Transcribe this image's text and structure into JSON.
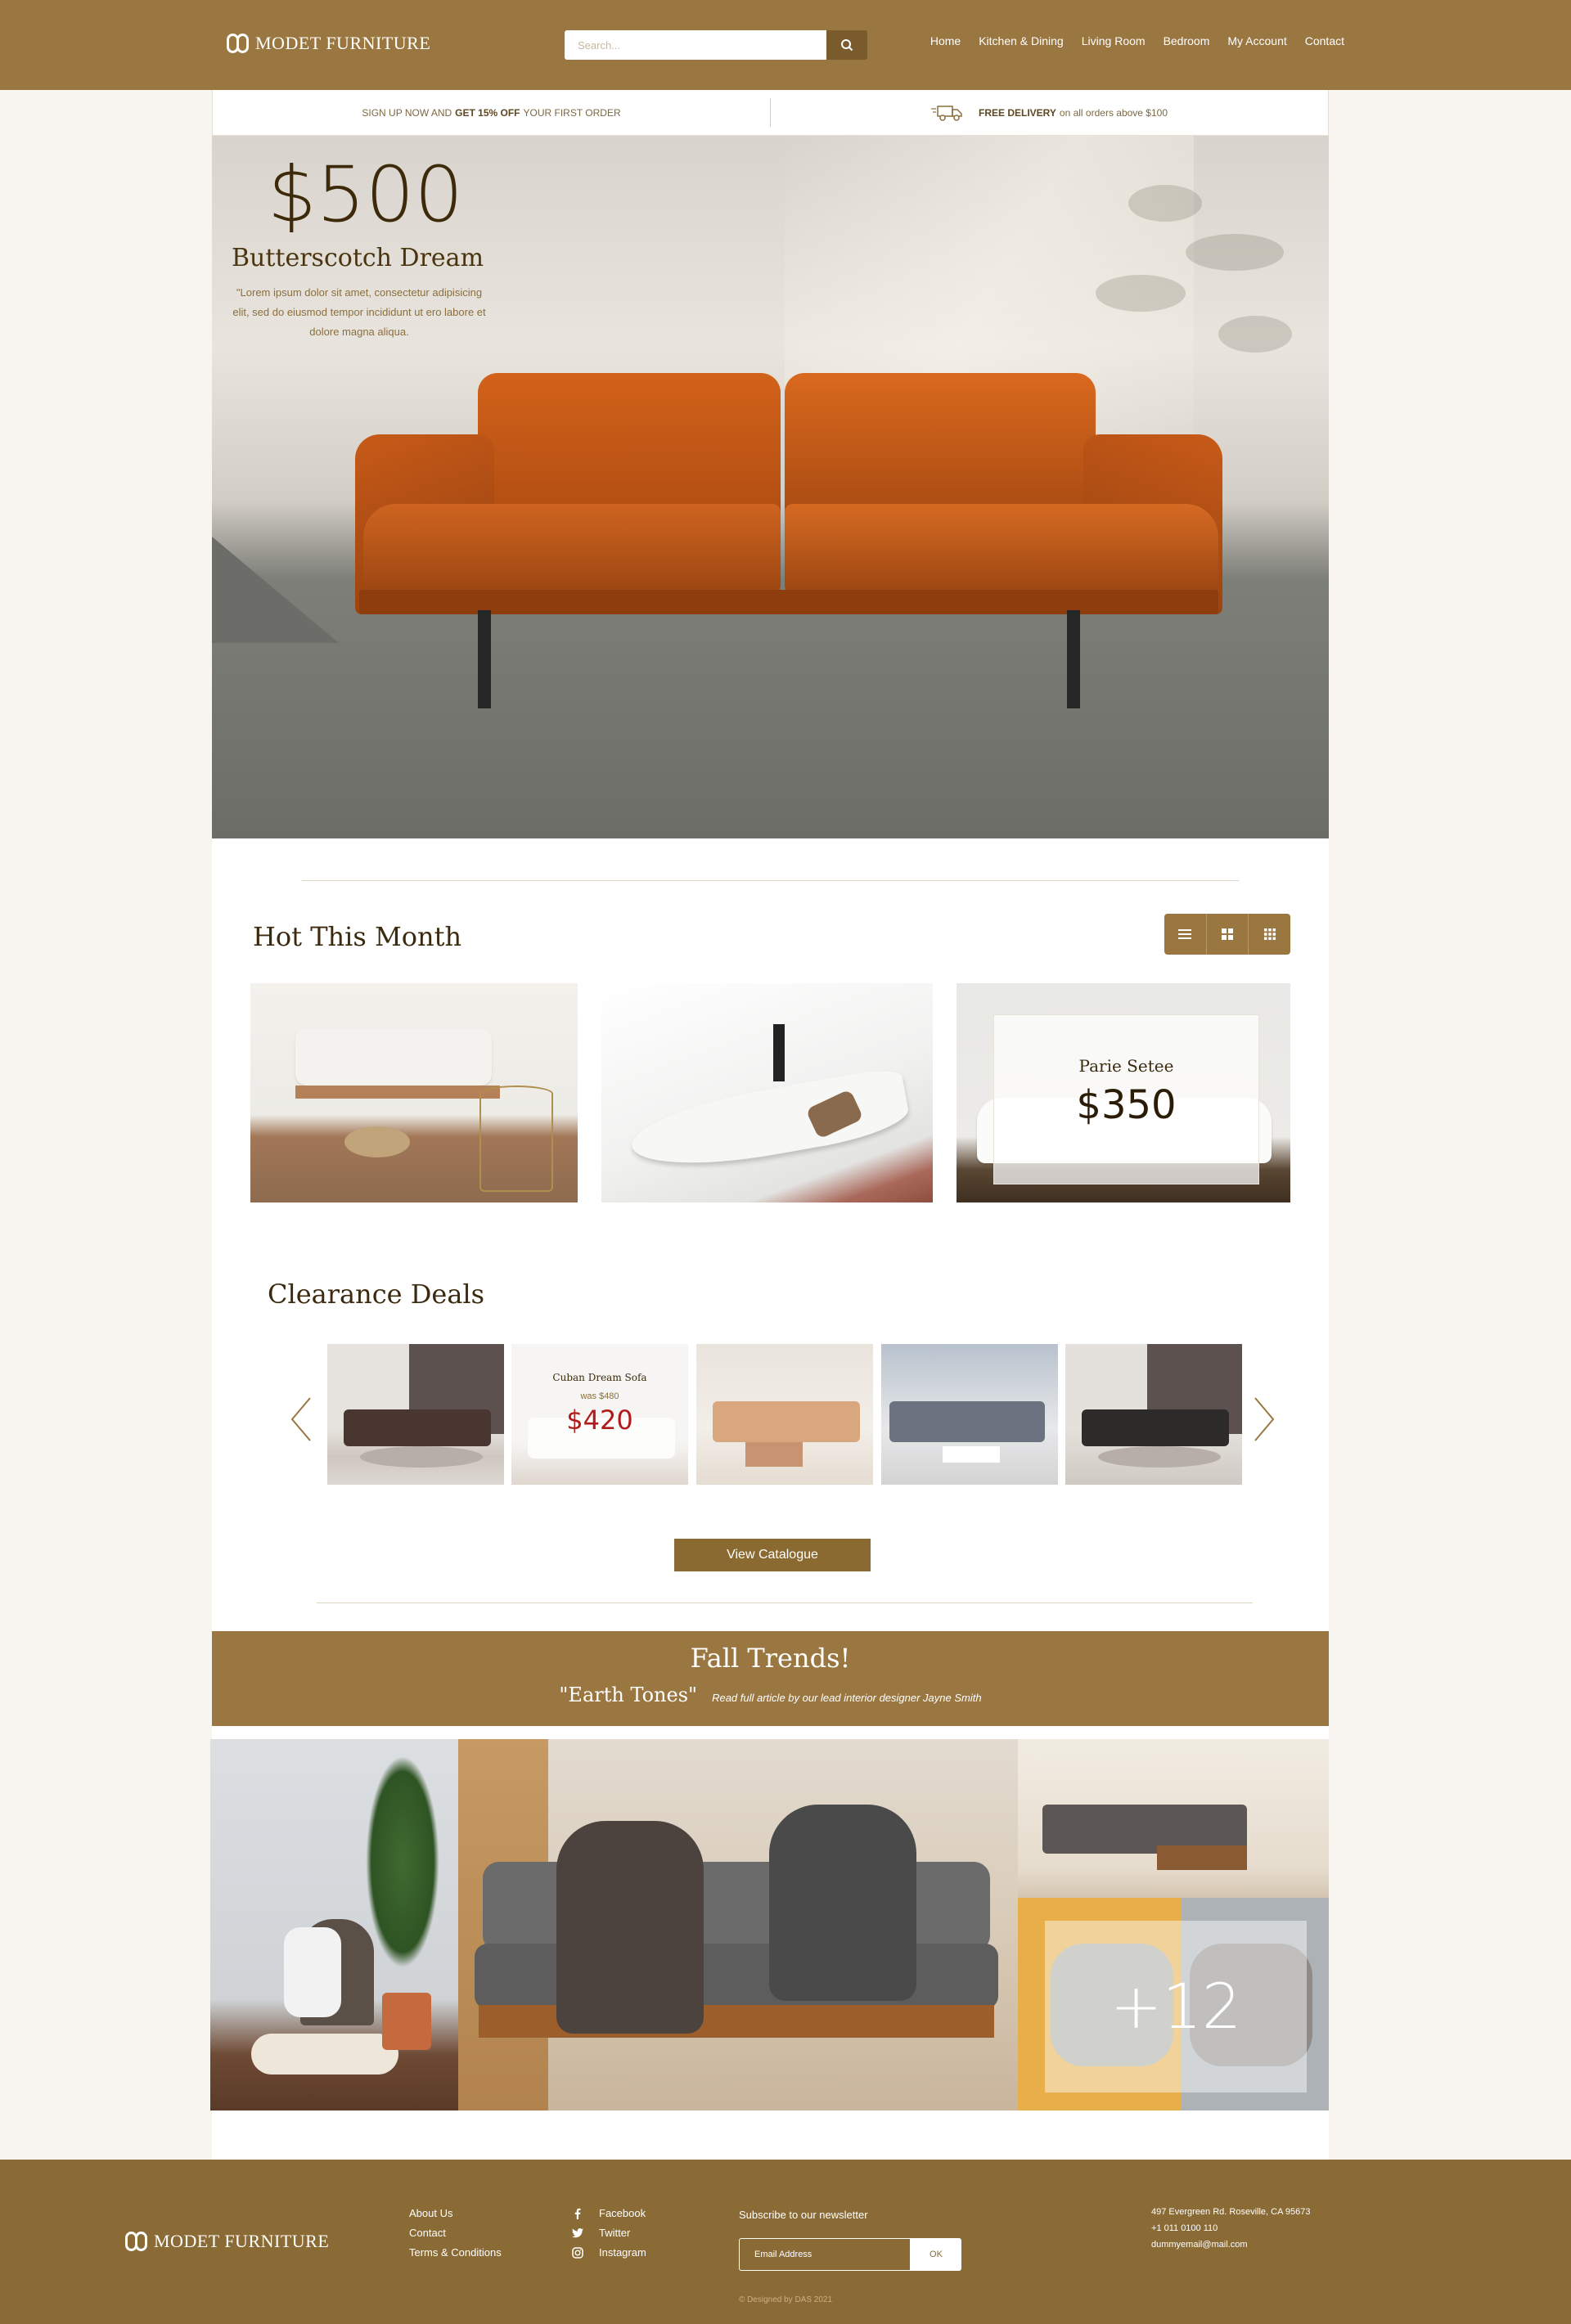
{
  "brand": {
    "name": "MODET FURNITURE"
  },
  "header": {
    "search_placeholder": "Search...",
    "nav": [
      "Home",
      "Kitchen & Dining",
      "Living Room",
      "Bedroom",
      "My Account",
      "Contact"
    ]
  },
  "promo": {
    "signup_prefix": "SIGN UP NOW AND",
    "signup_bold": "GET 15% OFF",
    "signup_suffix": "YOUR FIRST ORDER",
    "delivery_bold": "FREE DELIVERY",
    "delivery_suffix": "on all orders above $100"
  },
  "hero": {
    "price": "$500",
    "title": "Butterscotch Dream",
    "description": "\"Lorem ipsum dolor sit amet, consectetur adipisicing elit, sed do eiusmod tempor incididunt ut ero labore et dolore magna aliqua."
  },
  "hot": {
    "title": "Hot This Month",
    "featured": {
      "name": "Parie Setee",
      "price": "$350"
    }
  },
  "clearance": {
    "title": "Clearance Deals",
    "featured": {
      "name": "Cuban Dream Sofa",
      "was": "was $480",
      "price": "$420"
    },
    "button": "View Catalogue"
  },
  "trends": {
    "title": "Fall Trends!",
    "quote": "\"Earth Tones\"",
    "subtitle": "Read full article by our lead interior designer Jayne Smith",
    "more": "+12"
  },
  "footer": {
    "links": [
      "About Us",
      "Contact",
      "Terms & Conditions"
    ],
    "social": [
      "Facebook",
      "Twitter",
      "Instagram"
    ],
    "newsletter_label": "Subscribe to our newsletter",
    "email_placeholder": "Email Address",
    "ok": "OK",
    "address": "497 Evergreen Rd. Roseville, CA 95673",
    "phone": "+1 011 0100 110",
    "email": "dummyemail@mail.com",
    "copyright": "© Designed by DAS 2021"
  },
  "colors": {
    "brand": "#9a7740",
    "dark_brown": "#3b2a0e",
    "sale_red": "#b01c1c",
    "footer": "#8a6a35"
  }
}
